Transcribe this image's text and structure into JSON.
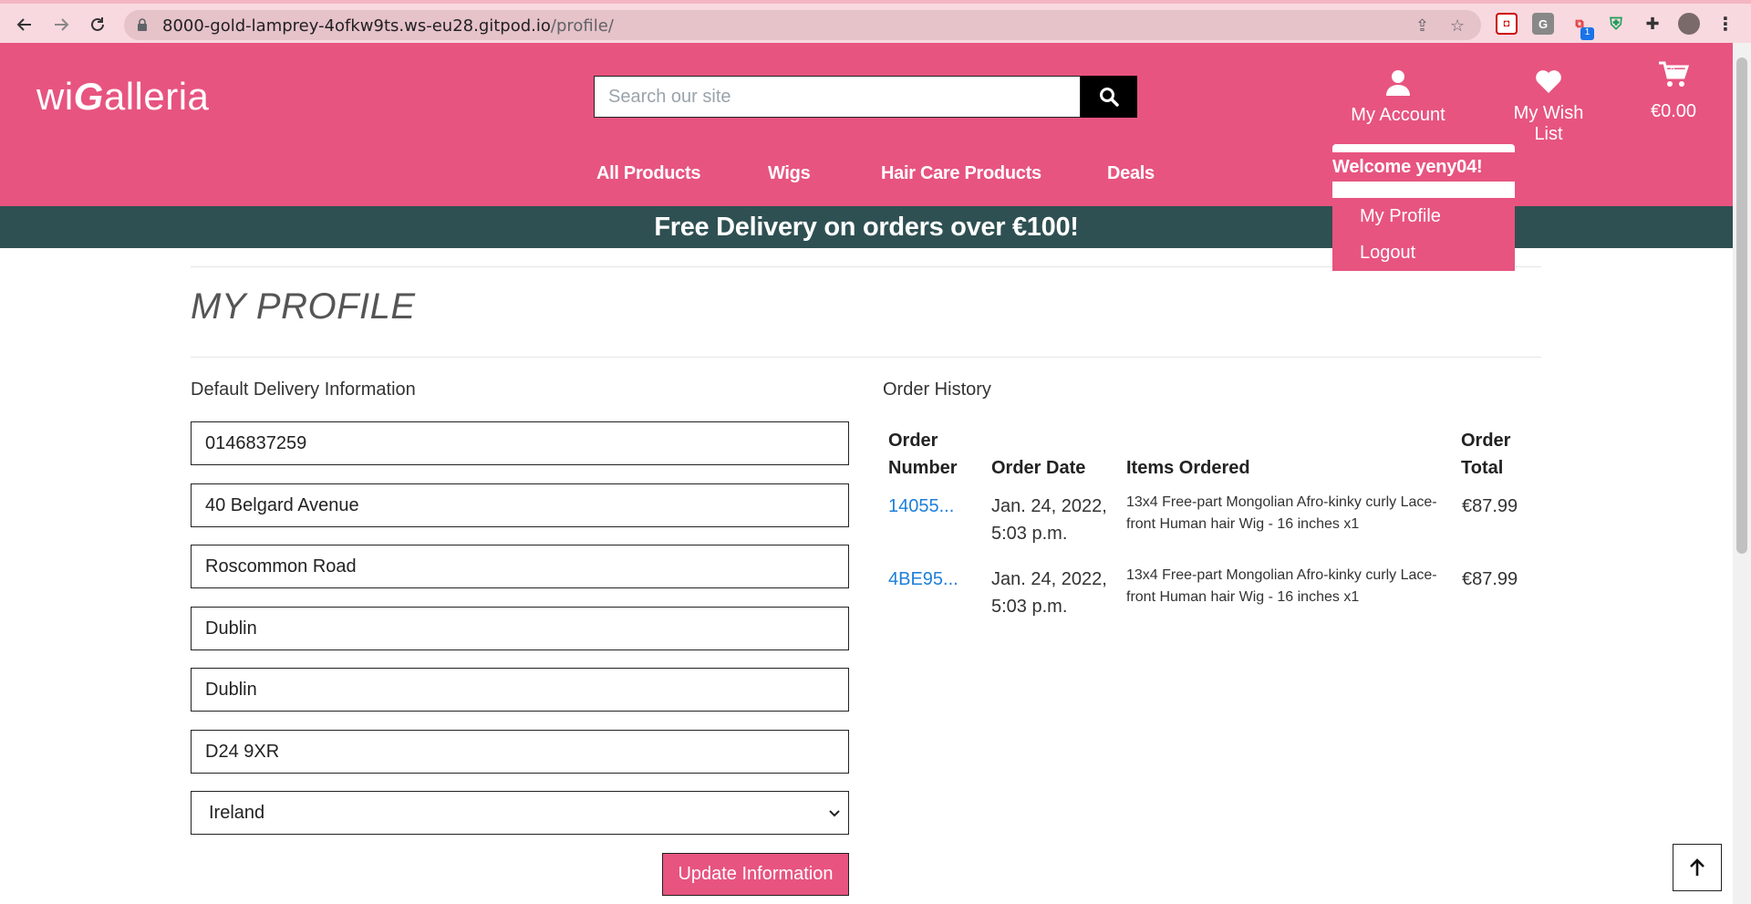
{
  "browser": {
    "url_host": "8000-gold-lamprey-4ofkw9ts.ws-eu28.gitpod.io",
    "url_path": "/profile/",
    "extension_badge": "1"
  },
  "header": {
    "logo_pre": "wi",
    "logo_g": "G",
    "logo_post": "alleria",
    "search_placeholder": "Search our site",
    "account_label": "My Account",
    "wishlist_label": "My Wish List",
    "cart_total": "€0.00",
    "cart_count": "0",
    "accent_color": "#e75480"
  },
  "nav": {
    "items": [
      "All Products",
      "Wigs",
      "Hair Care Products",
      "Deals"
    ]
  },
  "dropdown": {
    "welcome": "Welcome yeny04!",
    "profile": "My Profile",
    "logout": "Logout"
  },
  "banner": {
    "text": "Free Delivery on orders over €100!",
    "color": "#2f5052"
  },
  "page": {
    "title": "MY PROFILE"
  },
  "delivery": {
    "heading": "Default Delivery Information",
    "phone": "0146837259",
    "street1": "40 Belgard Avenue",
    "street2": "Roscommon Road",
    "town": "Dublin",
    "county": "Dublin",
    "postcode": "D24 9XR",
    "country": "Ireland",
    "update_label": "Update Information"
  },
  "orders": {
    "heading": "Order History",
    "headers": {
      "number_1": "Order",
      "number_2": "Number",
      "date": "Order Date",
      "items": "Items Ordered",
      "total_1": "Order",
      "total_2": "Total"
    },
    "rows": [
      {
        "number": "14055...",
        "date_1": "Jan. 24, 2022,",
        "date_2": "5:03 p.m.",
        "items_1": "13x4 Free-part Mongolian Afro-kinky curly Lace-",
        "items_2": "front Human hair Wig - 16 inches x1",
        "total": "€87.99"
      },
      {
        "number": "4BE95...",
        "date_1": "Jan. 24, 2022,",
        "date_2": "5:03 p.m.",
        "items_1": "13x4 Free-part Mongolian Afro-kinky curly Lace-",
        "items_2": "front Human hair Wig - 16 inches x1",
        "total": "€87.99"
      }
    ]
  }
}
